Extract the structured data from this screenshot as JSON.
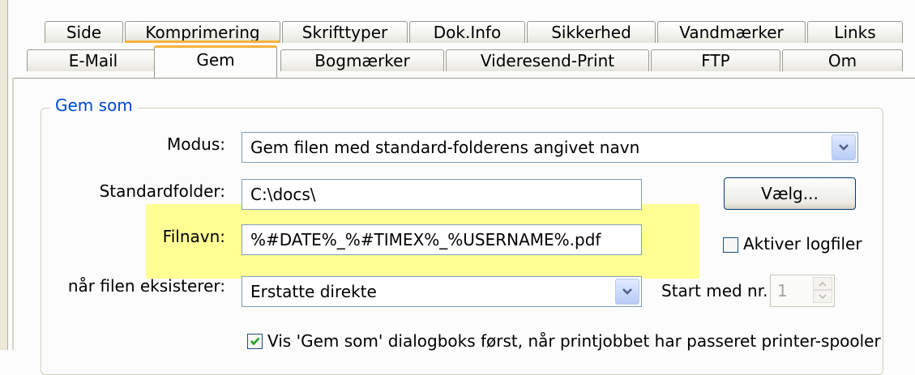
{
  "tabs": {
    "row1": [
      {
        "label": "Side"
      },
      {
        "label": "Komprimering"
      },
      {
        "label": "Skrifttyper"
      },
      {
        "label": "Dok.Info"
      },
      {
        "label": "Sikkerhed"
      },
      {
        "label": "Vandmærker"
      },
      {
        "label": "Links"
      }
    ],
    "row2": [
      {
        "label": "E-Mail"
      },
      {
        "label": "Gem"
      },
      {
        "label": "Bogmærker"
      },
      {
        "label": "Videresend-Print"
      },
      {
        "label": "FTP"
      },
      {
        "label": "Om"
      }
    ],
    "selected": "Gem"
  },
  "group": {
    "title": "Gem som",
    "modus": {
      "label": "Modus:",
      "value": "Gem filen med standard-folderens angivet navn"
    },
    "standardfolder": {
      "label": "Standardfolder:",
      "value": "C:\\docs\\",
      "button_label": "Vælg..."
    },
    "filnavn": {
      "label": "Filnavn:",
      "value": "%#DATE%_%#TIMEX%_%USERNAME%.pdf"
    },
    "logfiler": {
      "label": "Aktiver logfiler",
      "checked": false
    },
    "exists": {
      "label": "når filen eksisterer:",
      "value": "Erstatte direkte"
    },
    "start": {
      "label": "Start med nr.",
      "value": "1"
    },
    "show_dialog": {
      "label": "Vis 'Gem som' dialogboks først, når printjobbet har passeret printer-spooler",
      "checked": true
    }
  },
  "colors": {
    "highlight": "#ffff80",
    "accent": "#f6b23a",
    "group_title": "#0046d5"
  }
}
